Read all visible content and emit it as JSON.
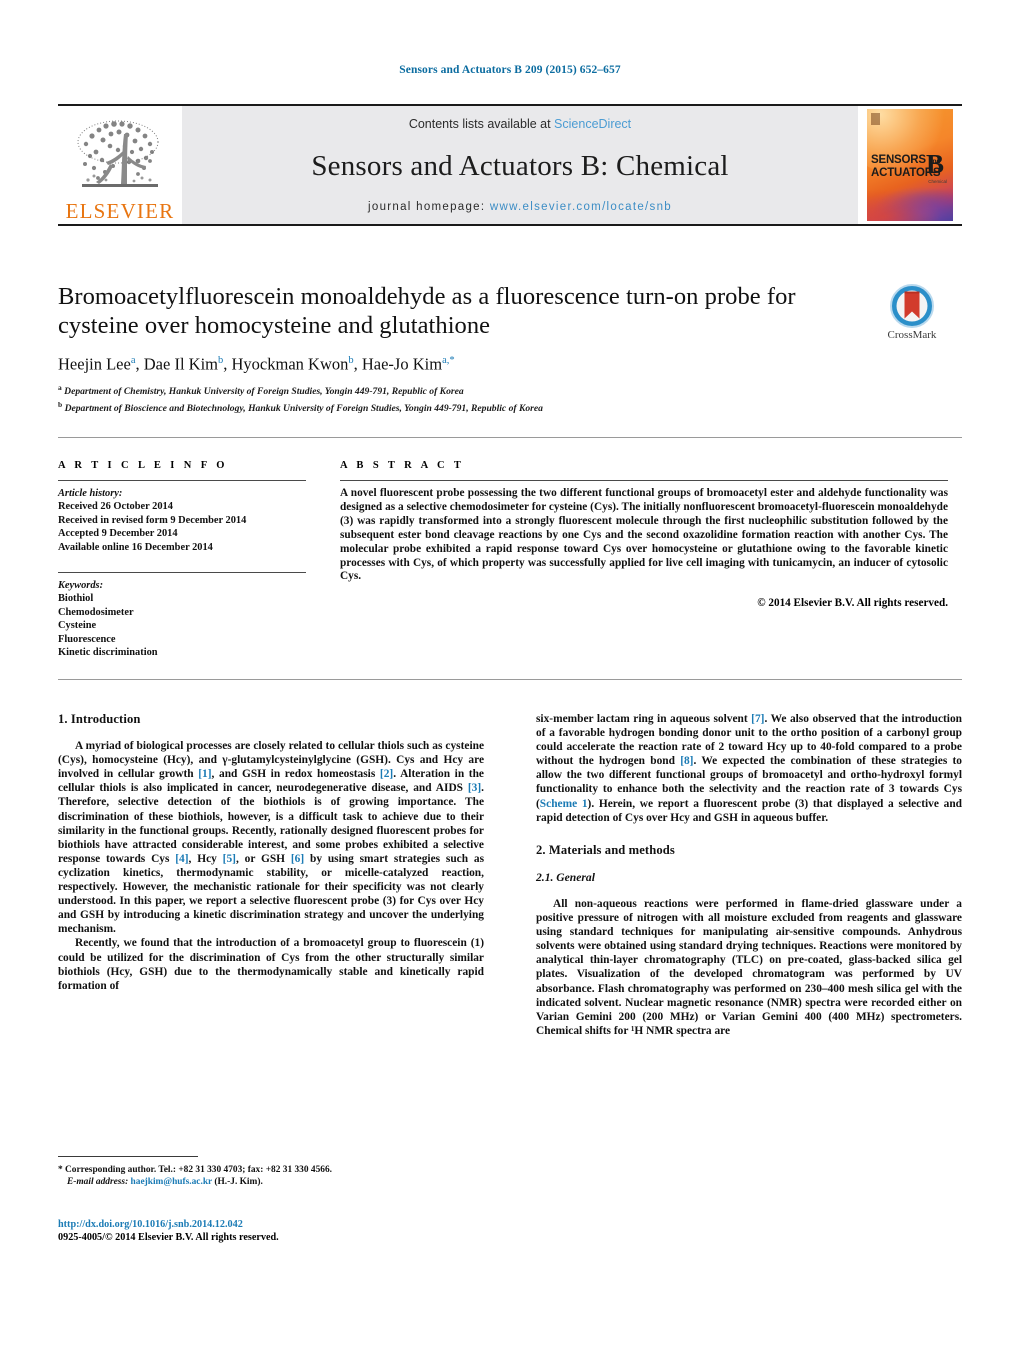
{
  "running_head": "Sensors and Actuators B 209 (2015) 652–657",
  "masthead": {
    "publisher_name": "ELSEVIER",
    "contents_prefix": "Contents lists available at ",
    "contents_link": "ScienceDirect",
    "journal_title": "Sensors and Actuators B: Chemical",
    "homepage_prefix": "journal homepage: ",
    "homepage_url": "www.elsevier.com/locate/snb",
    "cover": {
      "line1": "SENSORS",
      "and": "and",
      "line2": "ACTUATORS",
      "letter": "B",
      "sub": "Chemical"
    }
  },
  "crossmark": {
    "label": "CrossMark"
  },
  "article": {
    "title": "Bromoacetylfluorescein monoaldehyde as a fluorescence turn-on probe for cysteine over homocysteine and glutathione",
    "authors": [
      {
        "name": "Heejin Lee",
        "marks": "a"
      },
      {
        "name": "Dae Il Kim",
        "marks": "b"
      },
      {
        "name": "Hyockman Kwon",
        "marks": "b"
      },
      {
        "name": "Hae-Jo Kim",
        "marks": "a,*"
      }
    ],
    "affiliations": [
      {
        "mark": "a",
        "text": "Department of Chemistry, Hankuk University of Foreign Studies, Yongin 449-791, Republic of Korea"
      },
      {
        "mark": "b",
        "text": "Department of Bioscience and Biotechnology, Hankuk University of Foreign Studies, Yongin 449-791, Republic of Korea"
      }
    ]
  },
  "article_info": {
    "heading": "A R T I C L E   I N F O",
    "history_label": "Article history:",
    "history": [
      "Received 26 October 2014",
      "Received in revised form 9 December 2014",
      "Accepted 9 December 2014",
      "Available online 16 December 2014"
    ],
    "keywords_label": "Keywords:",
    "keywords": [
      "Biothiol",
      "Chemodosimeter",
      "Cysteine",
      "Fluorescence",
      "Kinetic discrimination"
    ]
  },
  "abstract": {
    "heading": "A B S T R A C T",
    "text": "A novel fluorescent probe possessing the two different functional groups of bromoacetyl ester and aldehyde functionality was designed as a selective chemodosimeter for cysteine (Cys). The initially nonfluorescent bromoacetyl-fluorescein monoaldehyde (3) was rapidly transformed into a strongly fluorescent molecule through the first nucleophilic substitution followed by the subsequent ester bond cleavage reactions by one Cys and the second oxazolidine formation reaction with another Cys. The molecular probe exhibited a rapid response toward Cys over homocysteine or glutathione owing to the favorable kinetic processes with Cys, of which property was successfully applied for live cell imaging with tunicamycin, an inducer of cytosolic Cys.",
    "copyright": "© 2014 Elsevier B.V. All rights reserved."
  },
  "body": {
    "section1_heading": "1.  Introduction",
    "p1_a": "A myriad of biological processes are closely related to cellular thiols such as cysteine (Cys), homocysteine (Hcy), and γ-glutamylcysteinylglycine (GSH). Cys and Hcy are involved in cellular growth ",
    "p1_r1": "[1]",
    "p1_b": ", and GSH in redox homeostasis ",
    "p1_r2": "[2]",
    "p1_c": ". Alteration in the cellular thiols is also implicated in cancer, neurodegenerative disease, and AIDS ",
    "p1_r3": "[3]",
    "p1_d": ". Therefore, selective detection of the biothiols is of growing importance. The discrimination of these biothiols, however, is a difficult task to achieve due to their similarity in the functional groups. Recently, rationally designed fluorescent probes for biothiols have attracted considerable interest, and some probes exhibited a selective response towards Cys ",
    "p1_r4": "[4]",
    "p1_e": ", Hcy ",
    "p1_r5": "[5]",
    "p1_f": ", or GSH ",
    "p1_r6": "[6]",
    "p1_g": " by using smart strategies such as cyclization kinetics, thermodynamic stability, or micelle-catalyzed reaction, respectively. However, the mechanistic rationale for their specificity was not clearly understood. In this paper, we report a selective fluorescent probe (3) for Cys over Hcy and GSH by introducing a kinetic discrimination strategy and uncover the underlying mechanism.",
    "p2": "Recently, we found that the introduction of a bromoacetyl group to fluorescein (1) could be utilized for the discrimination of Cys from the other structurally similar biothiols (Hcy, GSH) due to the thermodynamically stable and kinetically rapid formation of",
    "p3_a": "six-member lactam ring in aqueous solvent ",
    "p3_r7": "[7]",
    "p3_b": ". We also observed that the introduction of a favorable hydrogen bonding donor unit to the ortho position of a carbonyl group could accelerate the reaction rate of 2 toward Hcy up to 40-fold compared to a probe without the hydrogen bond ",
    "p3_r8": "[8]",
    "p3_c": ". We expected the combination of these strategies to allow the two different functional groups of bromoacetyl and ortho-hydroxyl formyl functionality to enhance both the selectivity and the reaction rate of 3 towards Cys (",
    "p3_scheme": "Scheme 1",
    "p3_d": "). Herein, we report a fluorescent probe (3) that displayed a selective and rapid detection of Cys over Hcy and GSH in aqueous buffer.",
    "section2_heading": "2.  Materials and methods",
    "section21_heading": "2.1.  General",
    "p4": "All non-aqueous reactions were performed in flame-dried glassware under a positive pressure of nitrogen with all moisture excluded from reagents and glassware using standard techniques for manipulating air-sensitive compounds. Anhydrous solvents were obtained using standard drying techniques. Reactions were monitored by analytical thin-layer chromatography (TLC) on pre-coated, glass-backed silica gel plates. Visualization of the developed chromatogram was performed by UV absorbance. Flash chromatography was performed on 230–400 mesh silica gel with the indicated solvent. Nuclear magnetic resonance (NMR) spectra were recorded either on Varian Gemini 200 (200 MHz) or Varian Gemini 400 (400 MHz) spectrometers. Chemical shifts for ¹H NMR spectra are"
  },
  "footer": {
    "star": "*",
    "corresponding_a": " Corresponding author. Tel.: +82 31 330 4703; fax: +82 31 330 4566.",
    "email_label": "E-mail address:",
    "email": "haejkim@hufs.ac.kr",
    "email_suffix": " (H.-J. Kim).",
    "doi": "http://dx.doi.org/10.1016/j.snb.2014.12.042",
    "issn_line": "0925-4005/© 2014 Elsevier B.V. All rights reserved."
  },
  "colors": {
    "link": "#1b7bb5",
    "runhead": "#0b6ca0",
    "elsevier_orange": "#e87511",
    "band_gray": "#e9e9eb"
  }
}
